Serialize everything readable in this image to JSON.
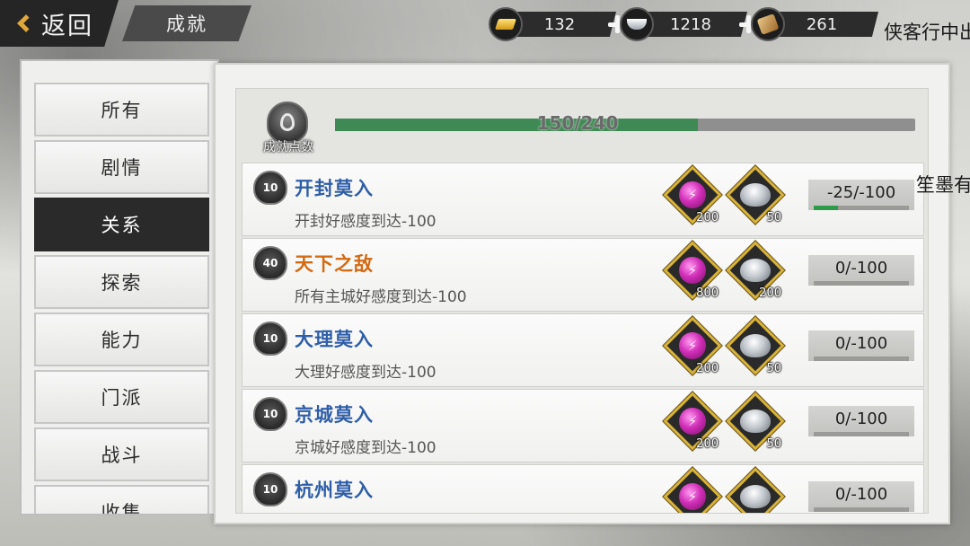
{
  "topbar": {
    "back_label": "返回",
    "title": "成就",
    "currencies": [
      {
        "name": "gold",
        "value": "132"
      },
      {
        "name": "silver",
        "value": "1218"
      },
      {
        "name": "scroll",
        "value": "261"
      }
    ],
    "right_text": "侠客行中出"
  },
  "overlay": {
    "right_text": "笙墨有"
  },
  "sidebar": {
    "items": [
      {
        "label": "所有"
      },
      {
        "label": "剧情"
      },
      {
        "label": "关系"
      },
      {
        "label": "探索"
      },
      {
        "label": "能力"
      },
      {
        "label": "门派"
      },
      {
        "label": "战斗"
      },
      {
        "label": "收集"
      }
    ],
    "active_index": 2
  },
  "points": {
    "label": "成就点数",
    "text": "150/240",
    "current": 150,
    "total": 240
  },
  "achievements": [
    {
      "points": "10",
      "title": "开封莫入",
      "title_color": "#2f5ea8",
      "desc": "开封好感度到达-100",
      "rewards": [
        {
          "type": "orb",
          "qty": "200"
        },
        {
          "type": "silver",
          "qty": "50"
        }
      ],
      "progress": "-25/-100",
      "fraction": 0.25
    },
    {
      "points": "40",
      "title": "天下之敌",
      "title_color": "#d46a12",
      "desc": "所有主城好感度到达-100",
      "rewards": [
        {
          "type": "orb",
          "qty": "800"
        },
        {
          "type": "silver",
          "qty": "200"
        }
      ],
      "progress": "0/-100",
      "fraction": 0
    },
    {
      "points": "10",
      "title": "大理莫入",
      "title_color": "#2f5ea8",
      "desc": "大理好感度到达-100",
      "rewards": [
        {
          "type": "orb",
          "qty": "200"
        },
        {
          "type": "silver",
          "qty": "50"
        }
      ],
      "progress": "0/-100",
      "fraction": 0
    },
    {
      "points": "10",
      "title": "京城莫入",
      "title_color": "#2f5ea8",
      "desc": "京城好感度到达-100",
      "rewards": [
        {
          "type": "orb",
          "qty": "200"
        },
        {
          "type": "silver",
          "qty": "50"
        }
      ],
      "progress": "0/-100",
      "fraction": 0
    },
    {
      "points": "10",
      "title": "杭州莫入",
      "title_color": "#2f5ea8",
      "desc": "",
      "rewards": [
        {
          "type": "orb",
          "qty": ""
        },
        {
          "type": "silver",
          "qty": ""
        }
      ],
      "progress": "0/-100",
      "fraction": 0
    }
  ]
}
